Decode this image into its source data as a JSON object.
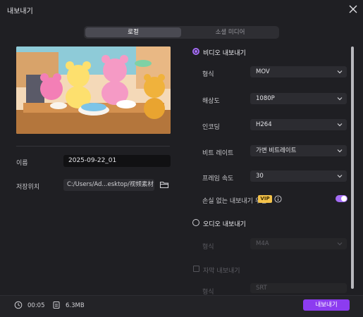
{
  "window": {
    "title": "내보내기"
  },
  "tabs": [
    {
      "label": "로컬",
      "active": true
    },
    {
      "label": "소셜 미디어",
      "active": false
    }
  ],
  "left": {
    "name_label": "이름",
    "name_value": "2025-09-22_01",
    "path_label": "저장위치",
    "path_value": "C:/Users/Ad...esktop/视频素材"
  },
  "video": {
    "title": "비디오 내보내기",
    "format_label": "형식",
    "format_value": "MOV",
    "resolution_label": "해상도",
    "resolution_value": "1080P",
    "encoder_label": "인코딩",
    "encoder_value": "H264",
    "bitrate_label": "비트 레이트",
    "bitrate_value": "가변 비트레이트",
    "framerate_label": "프레임 속도",
    "framerate_value": "30",
    "lossless_label": "손실 없는 내보내기 우선",
    "vip_badge": "VIP",
    "lossless_enabled": true
  },
  "audio": {
    "title": "오디오 내보내기",
    "format_label": "형식",
    "format_value": "M4A"
  },
  "subtitle": {
    "title": "자막 내보내기",
    "format_label": "형식",
    "format_value": "SRT"
  },
  "footer": {
    "duration": "00:05",
    "size": "6.3MB",
    "export_label": "내보내기"
  },
  "colors": {
    "accent": "#a46cf5",
    "export_button": "#8c3cf0",
    "vip": "#f3c24a",
    "background": "#1f1f23"
  }
}
